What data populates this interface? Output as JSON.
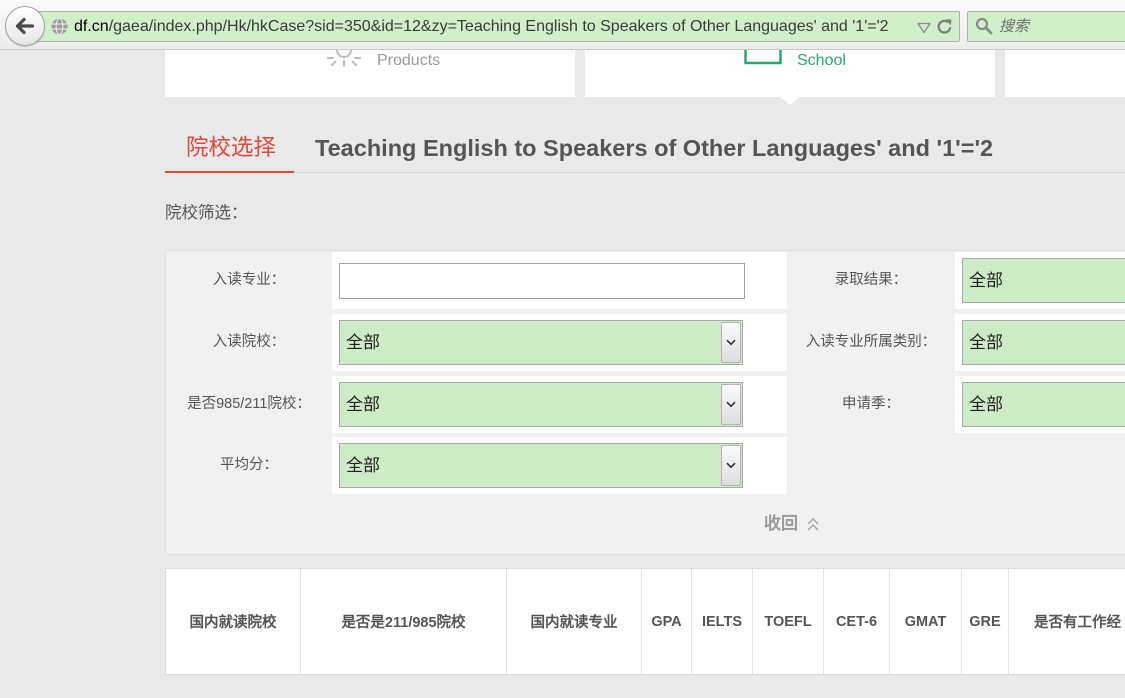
{
  "browser": {
    "url_domain": "df.cn",
    "url_path": "/gaea/index.php/Hk/hkCase?sid=350&id=12&zy=Teaching English to Speakers of Other Languages' and '1'='2",
    "search_placeholder": "搜索",
    "icons": {
      "back": "back-arrow-icon",
      "site": "globe-icon",
      "history": "dropdown-triangle-icon",
      "reload": "reload-icon",
      "search": "search-icon"
    }
  },
  "nav_cards": [
    {
      "label": "Products",
      "icon": "lightbulb-icon",
      "active": false
    },
    {
      "label": "School",
      "icon": "school-icon",
      "active": true
    }
  ],
  "tabs": [
    {
      "label": "院校选择",
      "active": true
    },
    {
      "label": "Teaching English to Speakers of Other Languages' and '1'='2",
      "active": false
    }
  ],
  "filter": {
    "heading": "院校筛选：",
    "fields": {
      "major": {
        "label": "入读专业：",
        "value": ""
      },
      "admission_result": {
        "label": "录取结果：",
        "value": "全部"
      },
      "school": {
        "label": "入读院校：",
        "value": "全部"
      },
      "major_category": {
        "label": "入读专业所属类别：",
        "value": "全部"
      },
      "school_985_211": {
        "label": "是否985/211院校：",
        "value": "全部"
      },
      "application_season": {
        "label": "申请季：",
        "value": "全部"
      },
      "average_score": {
        "label": "平均分：",
        "value": "全部"
      }
    },
    "collapse_label": "收回",
    "collapse_icon": "double-chevron-up-icon",
    "select_icon": "chevron-down-icon"
  },
  "table": {
    "headers": [
      "国内就读院校",
      "是否是211/985院校",
      "国内就读专业",
      "GPA",
      "IELTS",
      "TOEFL",
      "CET-6",
      "GMAT",
      "GRE",
      "是否有工作经"
    ]
  },
  "colors": {
    "accent_red": "#e2493b",
    "brand_green": "#2aa86c",
    "select_bg": "#cdebc6",
    "address_bar_bg": "#d2efcc",
    "page_bg": "#e9e9e9"
  }
}
